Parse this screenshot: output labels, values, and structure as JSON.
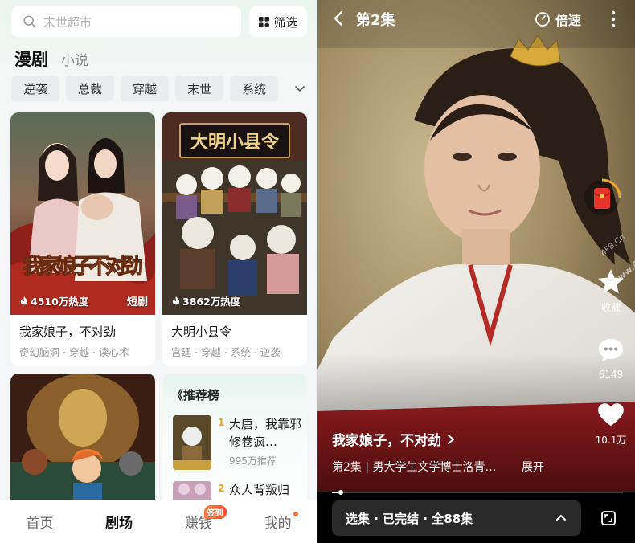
{
  "left": {
    "search": {
      "placeholder": "末世超市",
      "icon": "search-icon"
    },
    "filter_label": "筛选",
    "categories": [
      {
        "label": "漫剧",
        "active": true
      },
      {
        "label": "小说",
        "active": false
      }
    ],
    "tags": [
      "逆袭",
      "总裁",
      "穿越",
      "末世",
      "系统"
    ],
    "cards": [
      {
        "title": "我家娘子，不对劲",
        "subtitle": "奇幻脑洞 · 穿越 · 读心术",
        "heat": "4510万热度",
        "badge": "短剧"
      },
      {
        "title": "大明小县令",
        "subtitle": "宫廷 · 穿越 · 系统 · 逆袭",
        "heat": "3862万热度",
        "badge": ""
      }
    ],
    "poster_texts": {
      "card2_sign": "大明小县令",
      "card1_art": "我家娘子不对劲"
    },
    "ranking": {
      "title": "《推荐榜",
      "items": [
        {
          "rank": "1",
          "name": "大唐，我靠邪修卷疯…",
          "meta": "995万推荐"
        },
        {
          "rank": "2",
          "name": "众人背叛归",
          "meta": ""
        }
      ]
    },
    "nav": [
      {
        "label": "首页",
        "active": false
      },
      {
        "label": "剧场",
        "active": true
      },
      {
        "label": "赚钱",
        "active": false,
        "badge": "签到"
      },
      {
        "label": "我的",
        "active": false,
        "dot": true
      }
    ],
    "colors": {
      "accent": "#ff6b2c",
      "rank_gold": "#f0a020"
    }
  },
  "right": {
    "episode_title": "第2集",
    "speed_label": "倍速",
    "side_actions": [
      {
        "icon": "star-icon",
        "label": "收藏"
      },
      {
        "icon": "comment-icon",
        "label": "6149"
      },
      {
        "icon": "heart-icon",
        "label": "10.1万"
      }
    ],
    "watermark": [
      "4FB.Cn",
      "www.4FB.Cn"
    ],
    "video_title": "我家娘子，不对劲",
    "video_desc": "第2集 | 男大学生文学博士洛青…",
    "expand_label": "展开",
    "progress": 0.03,
    "episode_selector": "选集 · 已完结 · 全88集"
  }
}
